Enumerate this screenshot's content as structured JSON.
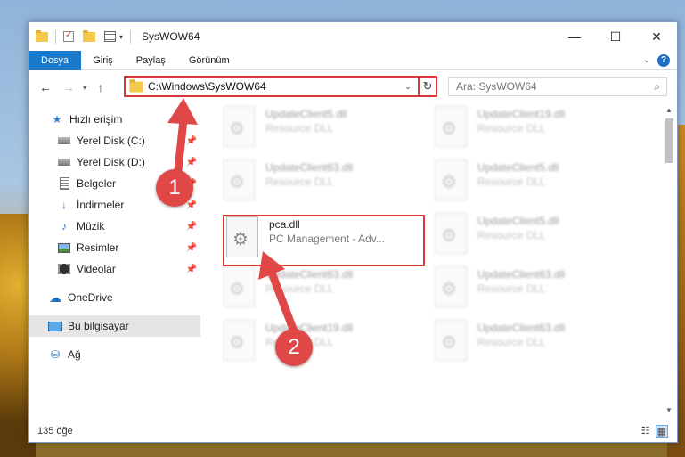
{
  "window": {
    "title": "SysWOW64",
    "controls": {
      "minimize": "—",
      "maximize": "☐",
      "close": "✕"
    }
  },
  "ribbon": {
    "tabs": [
      "Dosya",
      "Giriş",
      "Paylaş",
      "Görünüm"
    ],
    "active_tab": "Dosya",
    "help": "?"
  },
  "address": {
    "path": "C:\\Windows\\SysWOW64",
    "search_placeholder": "Ara: SysWOW64"
  },
  "sidebar": {
    "items": [
      {
        "label": "Hızlı erişim",
        "icon": "star-icon",
        "pinned": false
      },
      {
        "label": "Yerel Disk (C:)",
        "icon": "disk-icon",
        "pinned": true
      },
      {
        "label": "Yerel Disk (D:)",
        "icon": "disk-icon",
        "pinned": true
      },
      {
        "label": "Belgeler",
        "icon": "documents-icon",
        "pinned": true
      },
      {
        "label": "İndirmeler",
        "icon": "download-icon",
        "pinned": true
      },
      {
        "label": "Müzik",
        "icon": "music-icon",
        "pinned": true
      },
      {
        "label": "Resimler",
        "icon": "pictures-icon",
        "pinned": true
      },
      {
        "label": "Videolar",
        "icon": "videos-icon",
        "pinned": true
      },
      {
        "label": "OneDrive",
        "icon": "cloud-icon",
        "pinned": false
      },
      {
        "label": "Bu bilgisayar",
        "icon": "computer-icon",
        "pinned": false,
        "selected": true
      },
      {
        "label": "Ağ",
        "icon": "network-icon",
        "pinned": false
      }
    ]
  },
  "files": [
    {
      "name": "UpdateClient5.dll",
      "desc": "Resource DLL",
      "blurred": true
    },
    {
      "name": "UpdateClient19.dll",
      "desc": "Resource DLL",
      "blurred": true
    },
    {
      "name": "UpdateClient63.dll",
      "desc": "Resource DLL",
      "blurred": true
    },
    {
      "name": "UpdateClient5.dll",
      "desc": "Resource DLL",
      "blurred": true
    },
    {
      "name": "pca.dll",
      "desc": "PC Management - Adv...",
      "blurred": false
    },
    {
      "name": "UpdateClient5.dll",
      "desc": "Resource DLL",
      "blurred": true
    },
    {
      "name": "UpdateClient63.dll",
      "desc": "Resource DLL",
      "blurred": true
    },
    {
      "name": "UpdateClient63.dll",
      "desc": "Resource DLL",
      "blurred": true
    },
    {
      "name": "UpdateClient19.dll",
      "desc": "Resource DLL",
      "blurred": true
    },
    {
      "name": "UpdateClient63.dll",
      "desc": "Resource DLL",
      "blurred": true
    }
  ],
  "status": {
    "item_count": "135 öğe"
  },
  "callouts": {
    "badge1": "1",
    "badge2": "2",
    "color": "#e04848"
  }
}
